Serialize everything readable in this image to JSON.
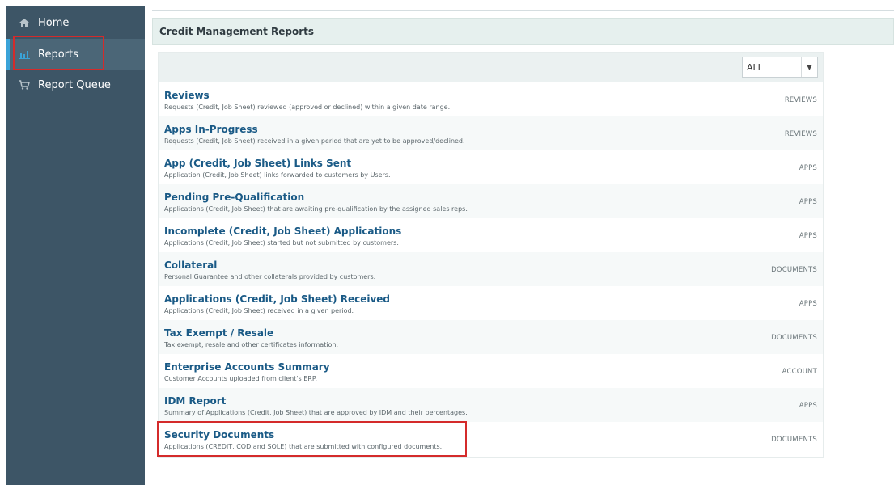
{
  "sidebar": {
    "items": [
      {
        "label": "Home",
        "icon": "home-icon"
      },
      {
        "label": "Reports",
        "icon": "bar-chart-icon",
        "active": true
      },
      {
        "label": "Report Queue",
        "icon": "cart-icon"
      }
    ]
  },
  "header": {
    "title": "Credit Management Reports"
  },
  "filter": {
    "selected": "ALL"
  },
  "reports": [
    {
      "title": "Reviews",
      "description": "Requests (Credit, Job Sheet) reviewed (approved or declined) within a given date range.",
      "category": "REVIEWS"
    },
    {
      "title": "Apps In-Progress",
      "description": "Requests (Credit, Job Sheet) received in a given period that are yet to be approved/declined.",
      "category": "REVIEWS"
    },
    {
      "title": "App (Credit, Job Sheet) Links Sent",
      "description": "Application (Credit, Job Sheet) links forwarded to customers by Users.",
      "category": "APPS"
    },
    {
      "title": "Pending Pre-Qualification",
      "description": "Applications (Credit, Job Sheet) that are awaiting pre-qualification by the assigned sales reps.",
      "category": "APPS"
    },
    {
      "title": "Incomplete (Credit, Job Sheet) Applications",
      "description": "Applications (Credit, Job Sheet) started but not submitted by customers.",
      "category": "APPS"
    },
    {
      "title": "Collateral",
      "description": "Personal Guarantee and other collaterals provided by customers.",
      "category": "DOCUMENTS"
    },
    {
      "title": "Applications (Credit, Job Sheet) Received",
      "description": "Applications (Credit, Job Sheet) received in a given period.",
      "category": "APPS"
    },
    {
      "title": "Tax Exempt / Resale",
      "description": "Tax exempt, resale and other certificates information.",
      "category": "DOCUMENTS"
    },
    {
      "title": "Enterprise Accounts Summary",
      "description": "Customer Accounts uploaded from client's ERP.",
      "category": "ACCOUNT"
    },
    {
      "title": "IDM Report",
      "description": "Summary of Applications (Credit, Job Sheet) that are approved by IDM and their percentages.",
      "category": "APPS"
    },
    {
      "title": "Security Documents",
      "description": "Applications (CREDIT, COD and SOLE) that are submitted with configured documents.",
      "category": "DOCUMENTS"
    }
  ],
  "colors": {
    "sidebar": "#3d5566",
    "link": "#1a5a86",
    "highlight": "#d42b2b",
    "accent": "#3aa3d8"
  }
}
